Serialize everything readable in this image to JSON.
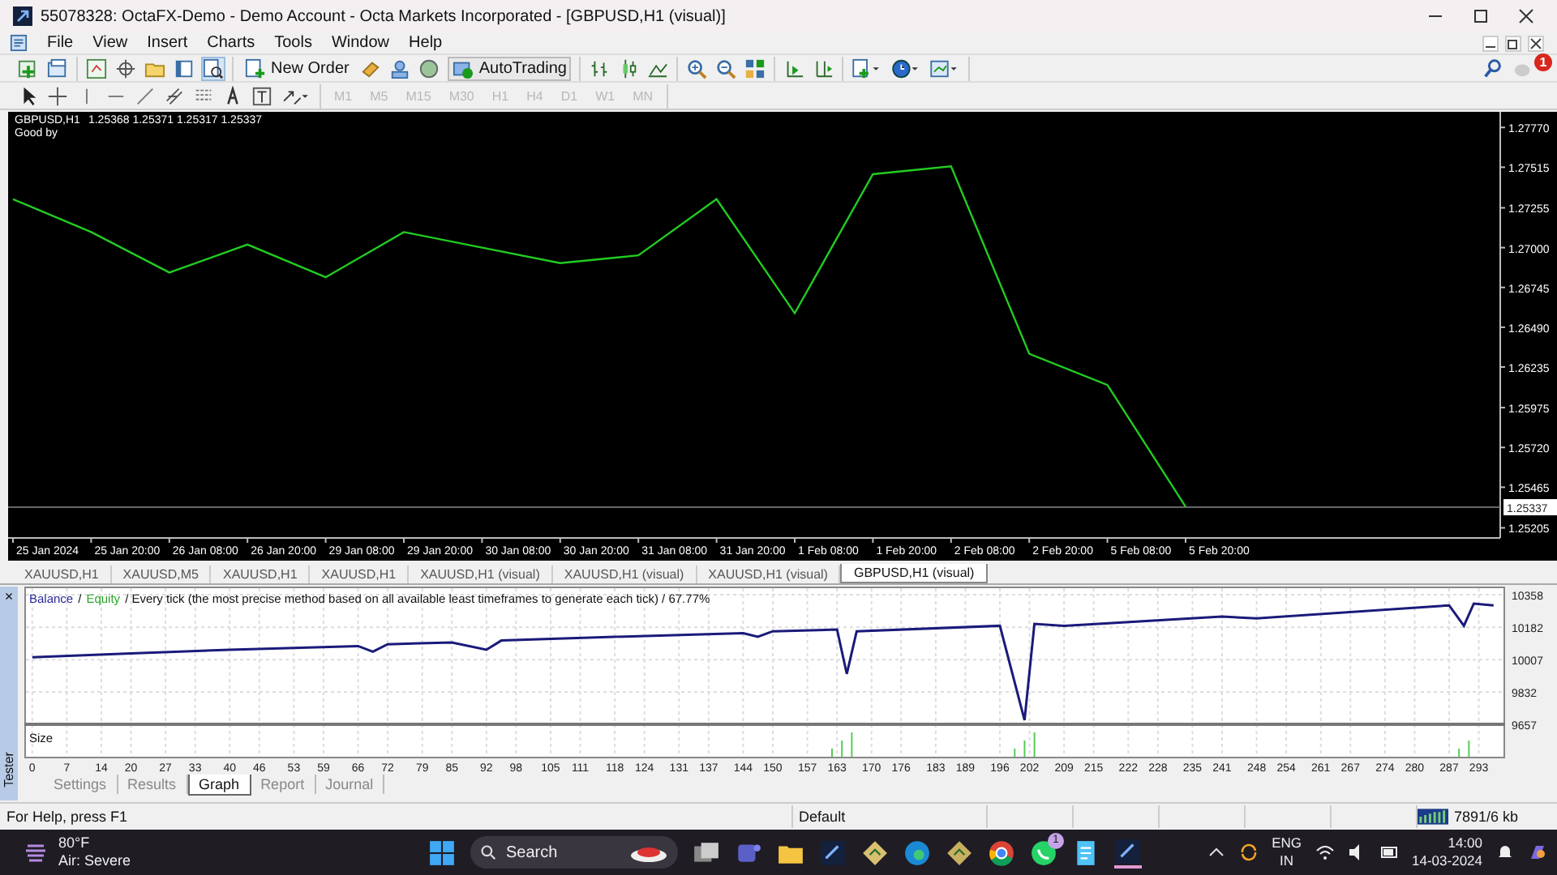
{
  "window": {
    "title": "55078328: OctaFX-Demo - Demo Account - Octa Markets Incorporated - [GBPUSD,H1 (visual)]"
  },
  "menu": [
    "File",
    "View",
    "Insert",
    "Charts",
    "Tools",
    "Window",
    "Help"
  ],
  "toolbar": {
    "new_order": "New Order",
    "autotrading": "AutoTrading",
    "notification_badge": "1"
  },
  "timeframes": [
    {
      "label": "M1",
      "disabled": true
    },
    {
      "label": "M5",
      "disabled": true
    },
    {
      "label": "M15",
      "disabled": true
    },
    {
      "label": "M30",
      "disabled": true
    },
    {
      "label": "H1",
      "disabled": true
    },
    {
      "label": "H4",
      "disabled": true
    },
    {
      "label": "D1",
      "disabled": true
    },
    {
      "label": "W1",
      "disabled": true
    },
    {
      "label": "MN",
      "disabled": true
    }
  ],
  "chart": {
    "quotes": "1.25368 1.25371 1.25317 1.25337",
    "comment": "Good by",
    "chart_data": {
      "type": "line",
      "categories": [
        "25 Jan 2024",
        "25 Jan 20:00",
        "26 Jan 08:00",
        "26 Jan 20:00",
        "29 Jan 08:00",
        "29 Jan 20:00",
        "30 Jan 08:00",
        "30 Jan 20:00",
        "31 Jan 08:00",
        "31 Jan 20:00",
        "1 Feb 08:00",
        "1 Feb 20:00",
        "2 Feb 08:00",
        "2 Feb 20:00",
        "5 Feb 08:00",
        "5 Feb 20:00"
      ],
      "series": [
        {
          "name": "GBPUSD,H1",
          "color": "#22cc22",
          "values": [
            1.2731,
            1.271,
            1.2684,
            1.2702,
            1.2681,
            1.271,
            1.27,
            1.269,
            1.2695,
            1.2731,
            1.2658,
            1.2747,
            1.2752,
            1.2632,
            1.2612,
            1.2534
          ]
        }
      ],
      "ylim": [
        1.2514,
        1.2787
      ],
      "ref_lines": [
        {
          "axis": "y",
          "value": 1.25337,
          "label": "1.25337"
        }
      ],
      "yticks": [
        {
          "value": 1.2777,
          "label": "1.27770"
        },
        {
          "value": 1.27515,
          "label": "1.27515"
        },
        {
          "value": 1.27255,
          "label": "1.27255"
        },
        {
          "value": 1.27,
          "label": "1.27000"
        },
        {
          "value": 1.26745,
          "label": "1.26745"
        },
        {
          "value": 1.2649,
          "label": "1.26490"
        },
        {
          "value": 1.26235,
          "label": "1.26235"
        },
        {
          "value": 1.25975,
          "label": "1.25975"
        },
        {
          "value": 1.2572,
          "label": "1.25720"
        },
        {
          "value": 1.25465,
          "label": "1.25465"
        },
        {
          "value": 1.25205,
          "label": "1.25205"
        }
      ]
    }
  },
  "chart_tabs": [
    {
      "label": "XAUUSD,H1",
      "selected": false
    },
    {
      "label": "XAUUSD,M5",
      "selected": false
    },
    {
      "label": "XAUUSD,H1",
      "selected": false
    },
    {
      "label": "XAUUSD,H1",
      "selected": false
    },
    {
      "label": "XAUUSD,H1 (visual)",
      "selected": false
    },
    {
      "label": "XAUUSD,H1 (visual)",
      "selected": false
    },
    {
      "label": "XAUUSD,H1 (visual)",
      "selected": false
    },
    {
      "label": "GBPUSD,H1 (visual)",
      "selected": true
    }
  ],
  "tester": {
    "title": "Tester",
    "close": "×",
    "separator": "/",
    "legend_equity": "Equity",
    "legend_text": "/ Every tick (the most precise method based on all available least timeframes to generate each tick) / 67.77%",
    "size_label": "Size",
    "chart_data": {
      "type": "line",
      "grid": true,
      "x": [
        0,
        20,
        40,
        66,
        69,
        72,
        85,
        92,
        95,
        118,
        144,
        147,
        150,
        163,
        165,
        167,
        196,
        201,
        203,
        209,
        241,
        248,
        287,
        290,
        292,
        296
      ],
      "series": [
        {
          "name": "Balance",
          "color": "#1a1a7a",
          "values": [
            10020,
            10040,
            10060,
            10080,
            10050,
            10090,
            10100,
            10060,
            10110,
            10130,
            10150,
            10130,
            10160,
            10170,
            9930,
            10160,
            10190,
            9680,
            10200,
            10190,
            10240,
            10230,
            10300,
            10190,
            10310,
            10300
          ]
        }
      ],
      "xlim": [
        -1.6,
        298
      ],
      "ylim": [
        9657,
        10402
      ],
      "xticks": [
        0,
        7,
        14,
        20,
        27,
        33,
        40,
        46,
        53,
        59,
        66,
        72,
        79,
        85,
        92,
        98,
        105,
        111,
        118,
        124,
        131,
        137,
        144,
        150,
        157,
        163,
        170,
        176,
        183,
        189,
        196,
        202,
        209,
        215,
        222,
        228,
        235,
        241,
        248,
        254,
        261,
        267,
        274,
        280,
        287,
        293
      ],
      "yticks": [
        9657,
        9832,
        10007,
        10182,
        10358
      ]
    },
    "tabs": [
      {
        "label": "Settings",
        "selected": false
      },
      {
        "label": "Results",
        "selected": false
      },
      {
        "label": "Graph",
        "selected": true
      },
      {
        "label": "Report",
        "selected": false
      },
      {
        "label": "Journal",
        "selected": false
      }
    ]
  },
  "status_bar": {
    "help": "For Help, press F1",
    "profile": "Default",
    "traffic": "7891/6 kb"
  },
  "taskbar": {
    "temperature": "80°F",
    "weather": "Air: Severe",
    "search": "Search",
    "whatsapp_badge": "1",
    "language": "ENG",
    "region": "IN",
    "time": "14:00",
    "date": "14-03-2024"
  }
}
